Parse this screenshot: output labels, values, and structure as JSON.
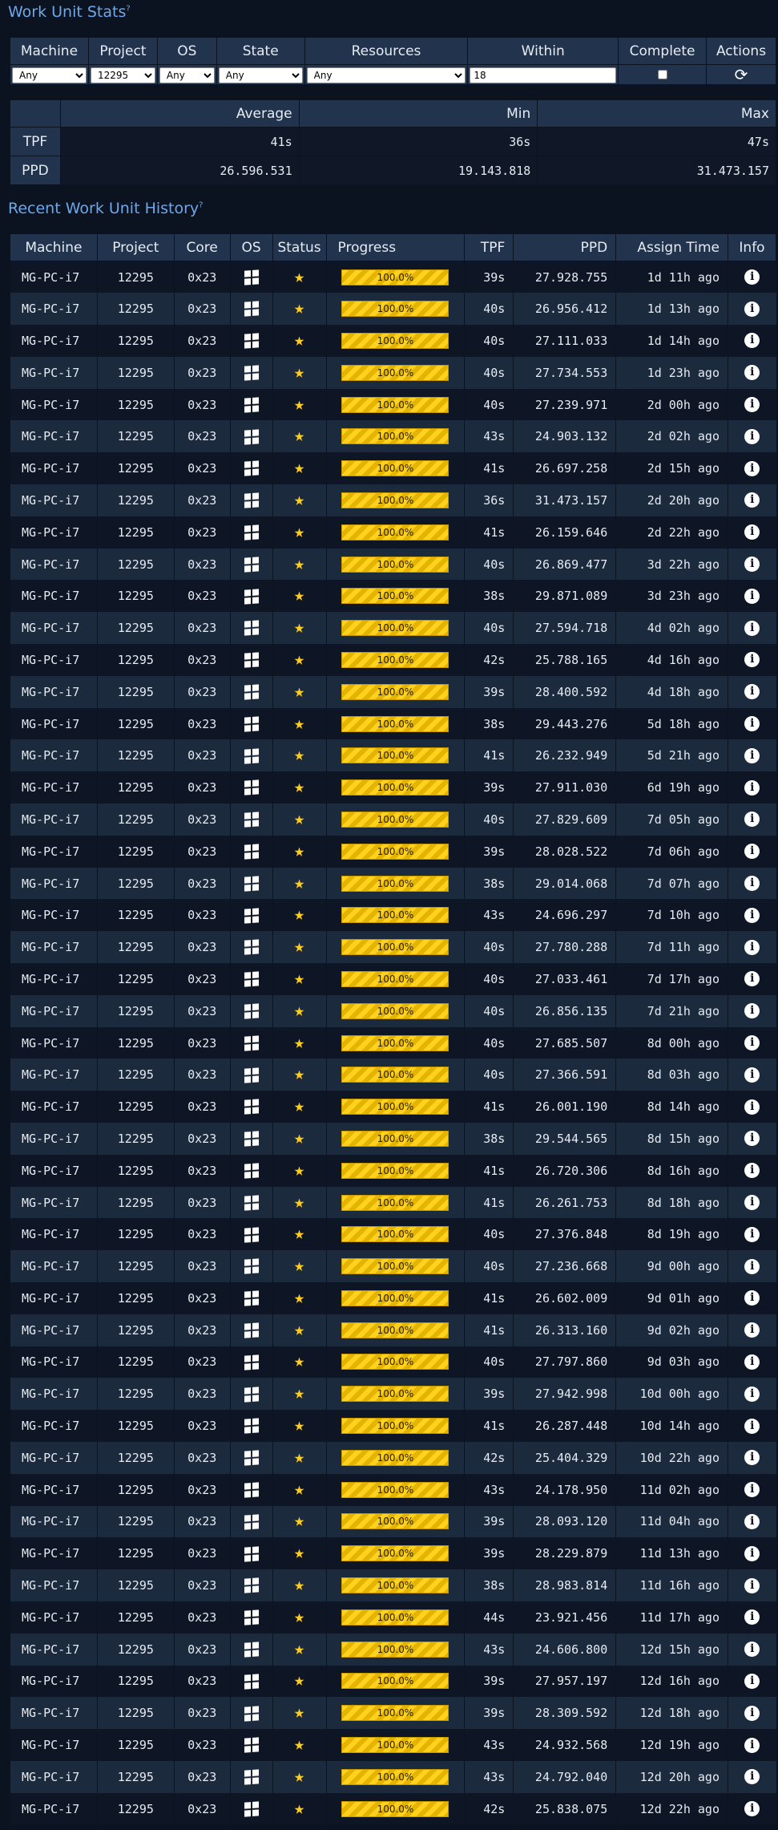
{
  "stats_section": {
    "title": "Work Unit Stats",
    "help": "?"
  },
  "filters": {
    "headers": [
      "Machine",
      "Project",
      "OS",
      "State",
      "Resources",
      "Within",
      "Complete",
      "Actions"
    ],
    "machine_value": "Any",
    "project_value": "12295",
    "os_value": "Any",
    "state_value": "Any",
    "resources_value": "Any",
    "within_value": "18",
    "complete_checked": false,
    "refresh_icon": "refresh-icon"
  },
  "summary": {
    "headers": [
      "",
      "Average",
      "Min",
      "Max"
    ],
    "rows": [
      {
        "label": "TPF",
        "average": "41s",
        "min": "36s",
        "max": "47s"
      },
      {
        "label": "PPD",
        "average": "26.596.531",
        "min": "19.143.818",
        "max": "31.473.157"
      }
    ]
  },
  "history_section": {
    "title": "Recent Work Unit History",
    "help": "?"
  },
  "history": {
    "headers": [
      "Machine",
      "Project",
      "Core",
      "OS",
      "Status",
      "Progress",
      "TPF",
      "PPD",
      "Assign Time",
      "Info"
    ],
    "colors": {
      "star": "#ffcc1a",
      "progress": "#ffd21f",
      "header_bg": "#22344d",
      "accent": "#6fa8e8"
    },
    "rows": [
      {
        "machine": "MG-PC-i7",
        "project": "12295",
        "core": "0x23",
        "progress": "100.0%",
        "tpf": "39s",
        "ppd": "27.928.755",
        "assign": "1d 11h ago"
      },
      {
        "machine": "MG-PC-i7",
        "project": "12295",
        "core": "0x23",
        "progress": "100.0%",
        "tpf": "40s",
        "ppd": "26.956.412",
        "assign": "1d 13h ago"
      },
      {
        "machine": "MG-PC-i7",
        "project": "12295",
        "core": "0x23",
        "progress": "100.0%",
        "tpf": "40s",
        "ppd": "27.111.033",
        "assign": "1d 14h ago"
      },
      {
        "machine": "MG-PC-i7",
        "project": "12295",
        "core": "0x23",
        "progress": "100.0%",
        "tpf": "40s",
        "ppd": "27.734.553",
        "assign": "1d 23h ago"
      },
      {
        "machine": "MG-PC-i7",
        "project": "12295",
        "core": "0x23",
        "progress": "100.0%",
        "tpf": "40s",
        "ppd": "27.239.971",
        "assign": "2d 00h ago"
      },
      {
        "machine": "MG-PC-i7",
        "project": "12295",
        "core": "0x23",
        "progress": "100.0%",
        "tpf": "43s",
        "ppd": "24.903.132",
        "assign": "2d 02h ago"
      },
      {
        "machine": "MG-PC-i7",
        "project": "12295",
        "core": "0x23",
        "progress": "100.0%",
        "tpf": "41s",
        "ppd": "26.697.258",
        "assign": "2d 15h ago"
      },
      {
        "machine": "MG-PC-i7",
        "project": "12295",
        "core": "0x23",
        "progress": "100.0%",
        "tpf": "36s",
        "ppd": "31.473.157",
        "assign": "2d 20h ago"
      },
      {
        "machine": "MG-PC-i7",
        "project": "12295",
        "core": "0x23",
        "progress": "100.0%",
        "tpf": "41s",
        "ppd": "26.159.646",
        "assign": "2d 22h ago"
      },
      {
        "machine": "MG-PC-i7",
        "project": "12295",
        "core": "0x23",
        "progress": "100.0%",
        "tpf": "40s",
        "ppd": "26.869.477",
        "assign": "3d 22h ago"
      },
      {
        "machine": "MG-PC-i7",
        "project": "12295",
        "core": "0x23",
        "progress": "100.0%",
        "tpf": "38s",
        "ppd": "29.871.089",
        "assign": "3d 23h ago"
      },
      {
        "machine": "MG-PC-i7",
        "project": "12295",
        "core": "0x23",
        "progress": "100.0%",
        "tpf": "40s",
        "ppd": "27.594.718",
        "assign": "4d 02h ago"
      },
      {
        "machine": "MG-PC-i7",
        "project": "12295",
        "core": "0x23",
        "progress": "100.0%",
        "tpf": "42s",
        "ppd": "25.788.165",
        "assign": "4d 16h ago"
      },
      {
        "machine": "MG-PC-i7",
        "project": "12295",
        "core": "0x23",
        "progress": "100.0%",
        "tpf": "39s",
        "ppd": "28.400.592",
        "assign": "4d 18h ago"
      },
      {
        "machine": "MG-PC-i7",
        "project": "12295",
        "core": "0x23",
        "progress": "100.0%",
        "tpf": "38s",
        "ppd": "29.443.276",
        "assign": "5d 18h ago"
      },
      {
        "machine": "MG-PC-i7",
        "project": "12295",
        "core": "0x23",
        "progress": "100.0%",
        "tpf": "41s",
        "ppd": "26.232.949",
        "assign": "5d 21h ago"
      },
      {
        "machine": "MG-PC-i7",
        "project": "12295",
        "core": "0x23",
        "progress": "100.0%",
        "tpf": "39s",
        "ppd": "27.911.030",
        "assign": "6d 19h ago"
      },
      {
        "machine": "MG-PC-i7",
        "project": "12295",
        "core": "0x23",
        "progress": "100.0%",
        "tpf": "40s",
        "ppd": "27.829.609",
        "assign": "7d 05h ago"
      },
      {
        "machine": "MG-PC-i7",
        "project": "12295",
        "core": "0x23",
        "progress": "100.0%",
        "tpf": "39s",
        "ppd": "28.028.522",
        "assign": "7d 06h ago"
      },
      {
        "machine": "MG-PC-i7",
        "project": "12295",
        "core": "0x23",
        "progress": "100.0%",
        "tpf": "38s",
        "ppd": "29.014.068",
        "assign": "7d 07h ago"
      },
      {
        "machine": "MG-PC-i7",
        "project": "12295",
        "core": "0x23",
        "progress": "100.0%",
        "tpf": "43s",
        "ppd": "24.696.297",
        "assign": "7d 10h ago"
      },
      {
        "machine": "MG-PC-i7",
        "project": "12295",
        "core": "0x23",
        "progress": "100.0%",
        "tpf": "40s",
        "ppd": "27.780.288",
        "assign": "7d 11h ago"
      },
      {
        "machine": "MG-PC-i7",
        "project": "12295",
        "core": "0x23",
        "progress": "100.0%",
        "tpf": "40s",
        "ppd": "27.033.461",
        "assign": "7d 17h ago"
      },
      {
        "machine": "MG-PC-i7",
        "project": "12295",
        "core": "0x23",
        "progress": "100.0%",
        "tpf": "40s",
        "ppd": "26.856.135",
        "assign": "7d 21h ago"
      },
      {
        "machine": "MG-PC-i7",
        "project": "12295",
        "core": "0x23",
        "progress": "100.0%",
        "tpf": "40s",
        "ppd": "27.685.507",
        "assign": "8d 00h ago"
      },
      {
        "machine": "MG-PC-i7",
        "project": "12295",
        "core": "0x23",
        "progress": "100.0%",
        "tpf": "40s",
        "ppd": "27.366.591",
        "assign": "8d 03h ago"
      },
      {
        "machine": "MG-PC-i7",
        "project": "12295",
        "core": "0x23",
        "progress": "100.0%",
        "tpf": "41s",
        "ppd": "26.001.190",
        "assign": "8d 14h ago"
      },
      {
        "machine": "MG-PC-i7",
        "project": "12295",
        "core": "0x23",
        "progress": "100.0%",
        "tpf": "38s",
        "ppd": "29.544.565",
        "assign": "8d 15h ago"
      },
      {
        "machine": "MG-PC-i7",
        "project": "12295",
        "core": "0x23",
        "progress": "100.0%",
        "tpf": "41s",
        "ppd": "26.720.306",
        "assign": "8d 16h ago"
      },
      {
        "machine": "MG-PC-i7",
        "project": "12295",
        "core": "0x23",
        "progress": "100.0%",
        "tpf": "41s",
        "ppd": "26.261.753",
        "assign": "8d 18h ago"
      },
      {
        "machine": "MG-PC-i7",
        "project": "12295",
        "core": "0x23",
        "progress": "100.0%",
        "tpf": "40s",
        "ppd": "27.376.848",
        "assign": "8d 19h ago"
      },
      {
        "machine": "MG-PC-i7",
        "project": "12295",
        "core": "0x23",
        "progress": "100.0%",
        "tpf": "40s",
        "ppd": "27.236.668",
        "assign": "9d 00h ago"
      },
      {
        "machine": "MG-PC-i7",
        "project": "12295",
        "core": "0x23",
        "progress": "100.0%",
        "tpf": "41s",
        "ppd": "26.602.009",
        "assign": "9d 01h ago"
      },
      {
        "machine": "MG-PC-i7",
        "project": "12295",
        "core": "0x23",
        "progress": "100.0%",
        "tpf": "41s",
        "ppd": "26.313.160",
        "assign": "9d 02h ago"
      },
      {
        "machine": "MG-PC-i7",
        "project": "12295",
        "core": "0x23",
        "progress": "100.0%",
        "tpf": "40s",
        "ppd": "27.797.860",
        "assign": "9d 03h ago"
      },
      {
        "machine": "MG-PC-i7",
        "project": "12295",
        "core": "0x23",
        "progress": "100.0%",
        "tpf": "39s",
        "ppd": "27.942.998",
        "assign": "10d 00h ago"
      },
      {
        "machine": "MG-PC-i7",
        "project": "12295",
        "core": "0x23",
        "progress": "100.0%",
        "tpf": "41s",
        "ppd": "26.287.448",
        "assign": "10d 14h ago"
      },
      {
        "machine": "MG-PC-i7",
        "project": "12295",
        "core": "0x23",
        "progress": "100.0%",
        "tpf": "42s",
        "ppd": "25.404.329",
        "assign": "10d 22h ago"
      },
      {
        "machine": "MG-PC-i7",
        "project": "12295",
        "core": "0x23",
        "progress": "100.0%",
        "tpf": "43s",
        "ppd": "24.178.950",
        "assign": "11d 02h ago"
      },
      {
        "machine": "MG-PC-i7",
        "project": "12295",
        "core": "0x23",
        "progress": "100.0%",
        "tpf": "39s",
        "ppd": "28.093.120",
        "assign": "11d 04h ago"
      },
      {
        "machine": "MG-PC-i7",
        "project": "12295",
        "core": "0x23",
        "progress": "100.0%",
        "tpf": "39s",
        "ppd": "28.229.879",
        "assign": "11d 13h ago"
      },
      {
        "machine": "MG-PC-i7",
        "project": "12295",
        "core": "0x23",
        "progress": "100.0%",
        "tpf": "38s",
        "ppd": "28.983.814",
        "assign": "11d 16h ago"
      },
      {
        "machine": "MG-PC-i7",
        "project": "12295",
        "core": "0x23",
        "progress": "100.0%",
        "tpf": "44s",
        "ppd": "23.921.456",
        "assign": "11d 17h ago"
      },
      {
        "machine": "MG-PC-i7",
        "project": "12295",
        "core": "0x23",
        "progress": "100.0%",
        "tpf": "43s",
        "ppd": "24.606.800",
        "assign": "12d 15h ago"
      },
      {
        "machine": "MG-PC-i7",
        "project": "12295",
        "core": "0x23",
        "progress": "100.0%",
        "tpf": "39s",
        "ppd": "27.957.197",
        "assign": "12d 16h ago"
      },
      {
        "machine": "MG-PC-i7",
        "project": "12295",
        "core": "0x23",
        "progress": "100.0%",
        "tpf": "39s",
        "ppd": "28.309.592",
        "assign": "12d 18h ago"
      },
      {
        "machine": "MG-PC-i7",
        "project": "12295",
        "core": "0x23",
        "progress": "100.0%",
        "tpf": "43s",
        "ppd": "24.932.568",
        "assign": "12d 19h ago"
      },
      {
        "machine": "MG-PC-i7",
        "project": "12295",
        "core": "0x23",
        "progress": "100.0%",
        "tpf": "43s",
        "ppd": "24.792.040",
        "assign": "12d 20h ago"
      },
      {
        "machine": "MG-PC-i7",
        "project": "12295",
        "core": "0x23",
        "progress": "100.0%",
        "tpf": "42s",
        "ppd": "25.838.075",
        "assign": "12d 22h ago"
      }
    ]
  }
}
